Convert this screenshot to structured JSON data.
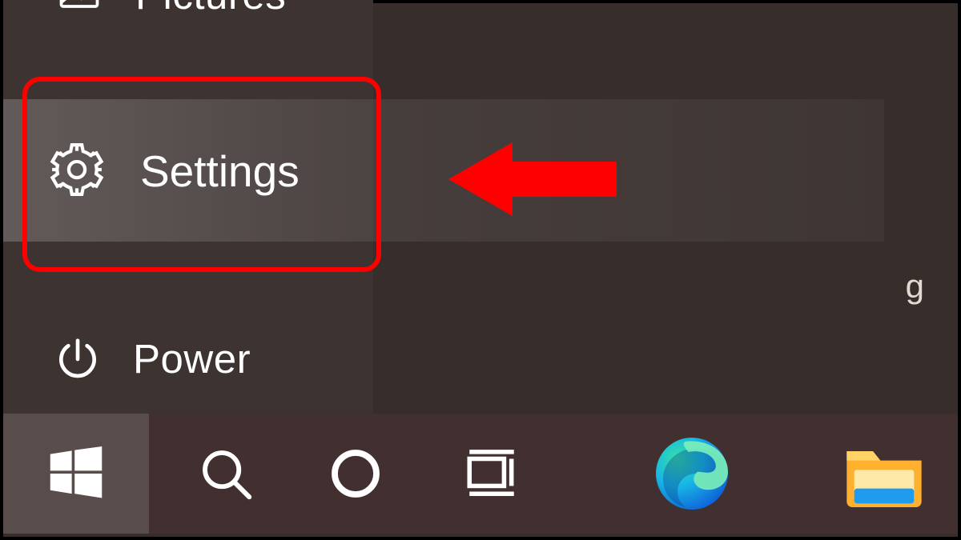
{
  "start_menu": {
    "items": {
      "pictures": "Pictures",
      "settings": "Settings",
      "power": "Power"
    }
  },
  "stray_char": "g",
  "annotation": {
    "highlight_target": "settings",
    "arrow_color": "#ff0000"
  },
  "taskbar": {
    "items": [
      "start",
      "search",
      "cortana",
      "task-view",
      "edge",
      "file-explorer"
    ]
  }
}
